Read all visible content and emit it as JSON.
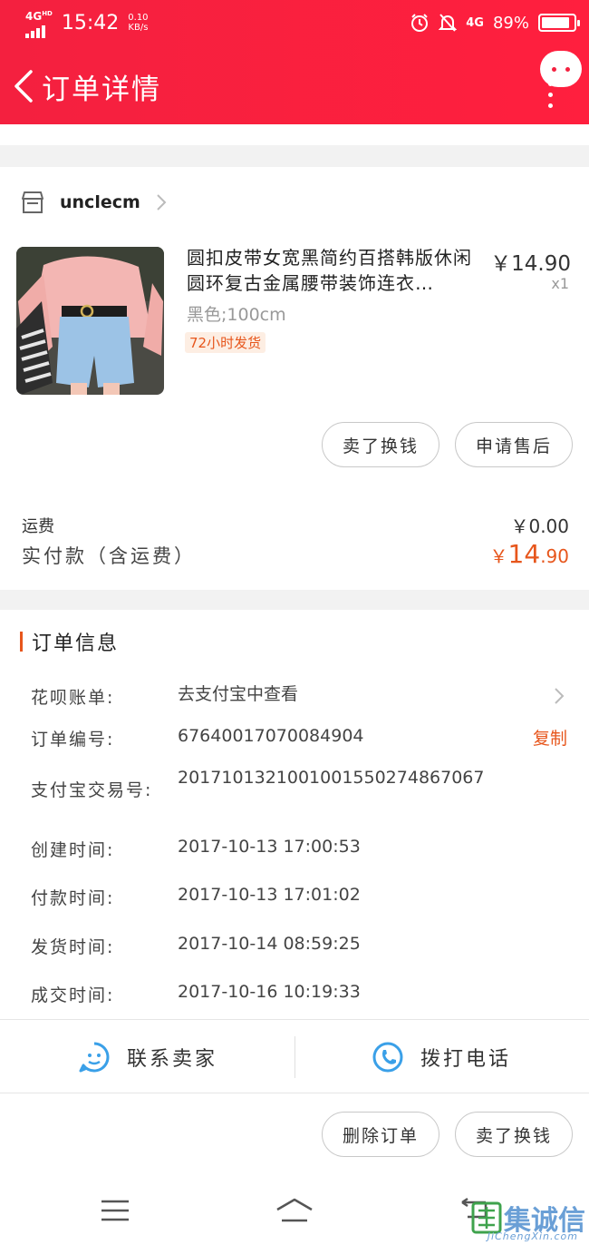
{
  "status_bar": {
    "network_tag": "4G",
    "network_tag_sup": "HD",
    "time": "15:42",
    "speed_value": "0.10",
    "speed_unit": "KB/s",
    "network_right": "4G",
    "battery": "89%"
  },
  "nav": {
    "title": "订单详情"
  },
  "shop": {
    "name": "unclecm"
  },
  "product": {
    "title": "圆扣皮带女宽黑简约百搭韩版休闲圆环复古金属腰带装饰连衣…",
    "price": "￥14.90",
    "quantity": "x1",
    "sku": "黑色;100cm",
    "shipping_tag": "72小时发货"
  },
  "item_actions": {
    "sell": "卖了换钱",
    "after_sale": "申请售后"
  },
  "fees": {
    "shipping_label": "运费",
    "shipping_value": "￥0.00",
    "paid_label": "实付款（含运费）",
    "paid_symbol": "￥",
    "paid_int": "14",
    "paid_dec": ".90"
  },
  "order_info": {
    "title": "订单信息",
    "copy_label": "复制",
    "rows": [
      {
        "key": "花呗账单:",
        "value": "去支付宝中查看"
      },
      {
        "key": "订单编号:",
        "value": "67640017070084904"
      },
      {
        "key": "支付宝交易号:",
        "value": "2017101321001001550274867067"
      },
      {
        "key": "创建时间:",
        "value": "2017-10-13 17:00:53"
      },
      {
        "key": "付款时间:",
        "value": "2017-10-13 17:01:02"
      },
      {
        "key": "发货时间:",
        "value": "2017-10-14 08:59:25"
      },
      {
        "key": "成交时间:",
        "value": "2017-10-16 10:19:33"
      }
    ]
  },
  "contact": {
    "seller": "联系卖家",
    "call": "拨打电话"
  },
  "bottom_actions": {
    "delete": "删除订单",
    "sell": "卖了换钱"
  },
  "watermark": {
    "text": "集诚信",
    "sub": "JiChengXin.com"
  },
  "colors": {
    "header": "#f4203f",
    "accent": "#e7561c",
    "icon_blue": "#3aa0e8"
  }
}
